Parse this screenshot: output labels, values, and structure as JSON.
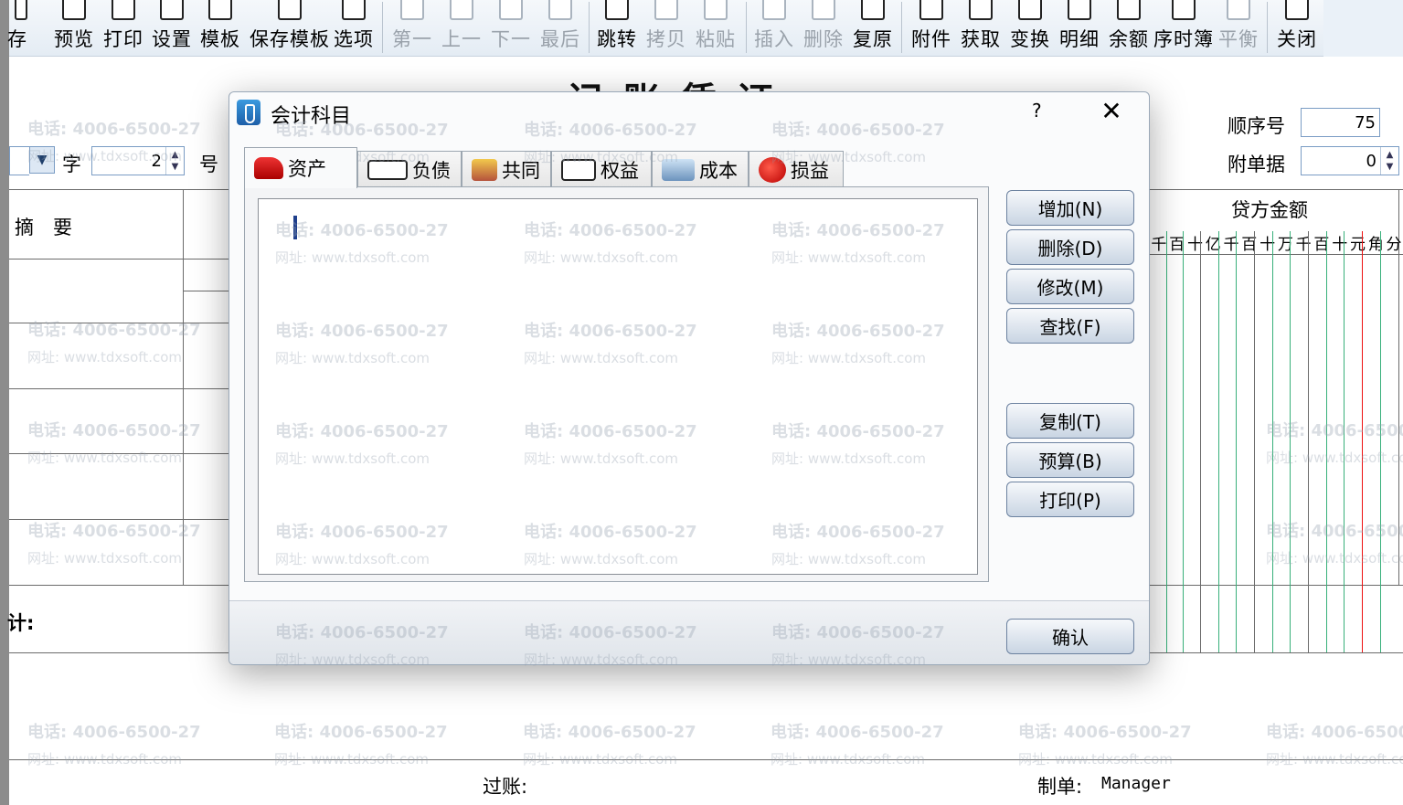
{
  "toolbar": {
    "buttons": [
      {
        "label": "存",
        "muted": false
      },
      {
        "label": "预览",
        "muted": false
      },
      {
        "label": "打印",
        "muted": false
      },
      {
        "label": "设置",
        "muted": false
      },
      {
        "label": "模板",
        "muted": false
      },
      {
        "label": "保存模板",
        "muted": false
      },
      {
        "label": "选项",
        "muted": false
      },
      {
        "label": "第一",
        "muted": true
      },
      {
        "label": "上一",
        "muted": true
      },
      {
        "label": "下一",
        "muted": true
      },
      {
        "label": "最后",
        "muted": true
      },
      {
        "label": "跳转",
        "muted": false
      },
      {
        "label": "拷贝",
        "muted": true
      },
      {
        "label": "粘贴",
        "muted": true
      },
      {
        "label": "插入",
        "muted": true
      },
      {
        "label": "删除",
        "muted": true
      },
      {
        "label": "复原",
        "muted": false
      },
      {
        "label": "附件",
        "muted": false
      },
      {
        "label": "获取",
        "muted": false
      },
      {
        "label": "变换",
        "muted": false
      },
      {
        "label": "明细",
        "muted": false
      },
      {
        "label": "余额",
        "muted": false
      },
      {
        "label": "序时簿",
        "muted": false
      },
      {
        "label": "平衡",
        "muted": true
      },
      {
        "label": "关闭",
        "muted": false
      }
    ]
  },
  "voucher": {
    "title": "记账凭证",
    "word_label": "字",
    "number_value": "2",
    "number_label": "号",
    "sequence_label": "顺序号",
    "sequence_value": "75",
    "attachments_label": "附单据",
    "attachments_value": "0",
    "summary_header": "摘　要",
    "credit_header": "贷方金额",
    "ruler_units": [
      "千",
      "百",
      "十",
      "亿",
      "千",
      "百",
      "十",
      "万",
      "千",
      "百",
      "十",
      "元",
      "角",
      "分"
    ],
    "total_label": "计:",
    "posted_label": "过账:",
    "maker_label": "制单:",
    "maker_value": "Manager"
  },
  "watermark": {
    "phone": "电话: 4006-6500-27",
    "url": "网址: www.tdxsoft.com"
  },
  "dialog": {
    "title": "会计科目",
    "help": "?",
    "close": "✕",
    "tabs": [
      {
        "label": "资产",
        "icon": "car-icon",
        "active": true
      },
      {
        "label": "负债",
        "icon": "card-icon",
        "active": false
      },
      {
        "label": "共同",
        "icon": "shared-icon",
        "active": false
      },
      {
        "label": "权益",
        "icon": "document-icon",
        "active": false
      },
      {
        "label": "成本",
        "icon": "coin-hand-icon",
        "active": false
      },
      {
        "label": "损益",
        "icon": "apple-icon",
        "active": false
      }
    ],
    "buttons": {
      "add": "增加(N)",
      "delete": "删除(D)",
      "modify": "修改(M)",
      "find": "查找(F)",
      "copy": "复制(T)",
      "budget": "预算(B)",
      "print": "打印(P)",
      "confirm": "确认"
    }
  }
}
